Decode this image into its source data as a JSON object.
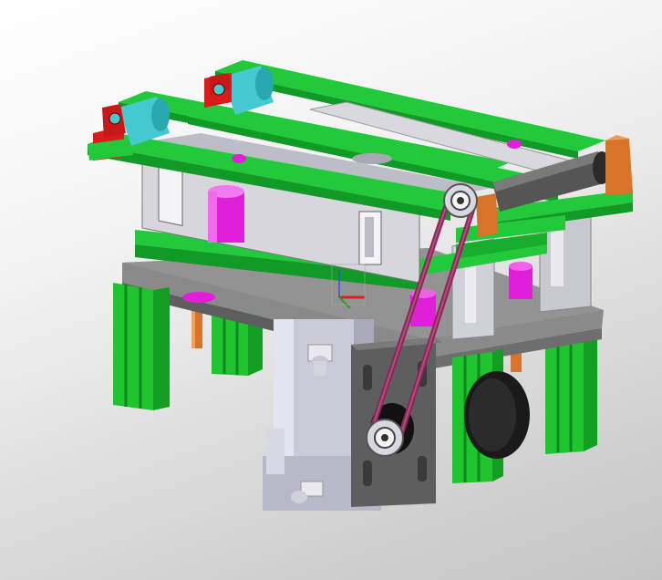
{
  "viewport": {
    "background_top": "#ffffff",
    "background_bottom": "#c4c4c4"
  },
  "model": {
    "colors": {
      "belt_green": "#22c93a",
      "belt_dark": "#119a25",
      "extrusion_green": "#1fc42f",
      "plate_gray": "#8a8a8a",
      "plate_dark": "#5e5e5e",
      "housing_gray": "#d6d6dc",
      "motor_silver": "#c9c9d8",
      "magenta": "#e020d8",
      "orange": "#d8742a",
      "red_block": "#d81c1c",
      "cyan_roller": "#45c8d0",
      "timing_belt": "#8a2858",
      "motor_black": "#1a1a1a"
    },
    "parts": [
      "conveyor-belts",
      "drive-roller",
      "idler-rollers",
      "pillow-blocks",
      "side-housing",
      "base-plate",
      "support-legs",
      "motor",
      "timing-belt",
      "pulleys",
      "magenta-guides",
      "orange-rods"
    ]
  }
}
